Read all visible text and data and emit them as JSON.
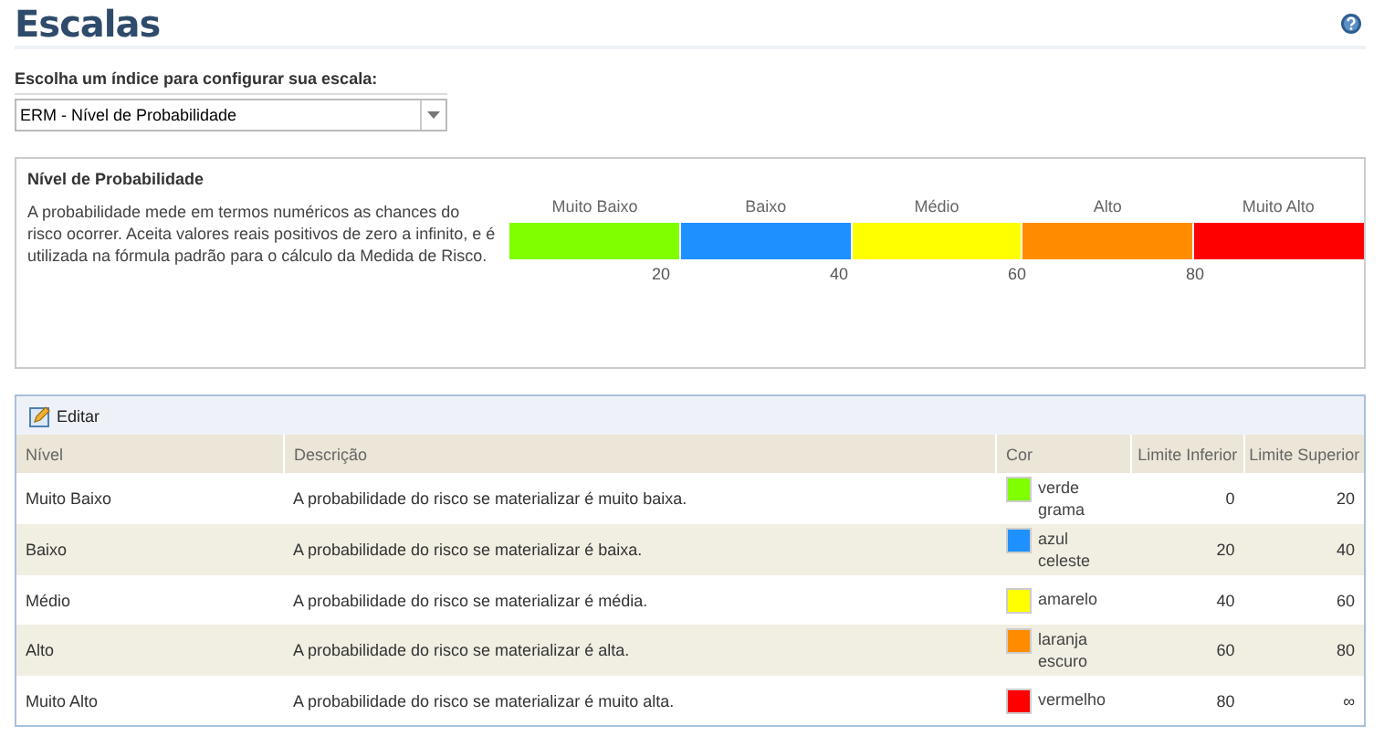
{
  "page": {
    "title": "Escalas"
  },
  "selector": {
    "label": "Escolha um índice para configurar sua escala:",
    "value": "ERM - Nível de Probabilidade"
  },
  "scale_panel": {
    "title": "Nível de Probabilidade",
    "description": "A probabilidade mede em termos numéricos as chances do risco ocorrer. Aceita valores reais positivos de zero a infinito, e é utilizada na fórmula padrão para o cálculo da Medida de Risco.",
    "segments": [
      {
        "label": "Muito Baixo",
        "color": "#7fff00"
      },
      {
        "label": "Baixo",
        "color": "#1e90ff"
      },
      {
        "label": "Médio",
        "color": "#ffff00"
      },
      {
        "label": "Alto",
        "color": "#ff8c00"
      },
      {
        "label": "Muito Alto",
        "color": "#ff0000"
      }
    ],
    "ticks": [
      "20",
      "40",
      "60",
      "80"
    ]
  },
  "toolbar": {
    "buttons": [
      "Editar"
    ]
  },
  "table": {
    "columns": [
      "Nível",
      "Descrição",
      "Cor",
      "Limite Inferior",
      "Limite Superior"
    ],
    "rows": [
      {
        "level": "Muito Baixo",
        "description": "A probabilidade do risco se materializar é muito baixa.",
        "color": "#7fff00",
        "color_name": "verde grama",
        "lower": "0",
        "upper": "20"
      },
      {
        "level": "Baixo",
        "description": "A probabilidade do risco se materializar é baixa.",
        "color": "#1e90ff",
        "color_name": "azul celeste",
        "lower": "20",
        "upper": "40"
      },
      {
        "level": "Médio",
        "description": "A probabilidade do risco se materializar é média.",
        "color": "#ffff00",
        "color_name": "amarelo",
        "lower": "40",
        "upper": "60"
      },
      {
        "level": "Alto",
        "description": "A probabilidade do risco se materializar é alta.",
        "color": "#ff8c00",
        "color_name": "laranja escuro",
        "lower": "60",
        "upper": "80"
      },
      {
        "level": "Muito Alto",
        "description": "A probabilidade do risco se materializar é muito alta.",
        "color": "#ff0000",
        "color_name": "vermelho",
        "lower": "80",
        "upper": "∞"
      }
    ]
  }
}
